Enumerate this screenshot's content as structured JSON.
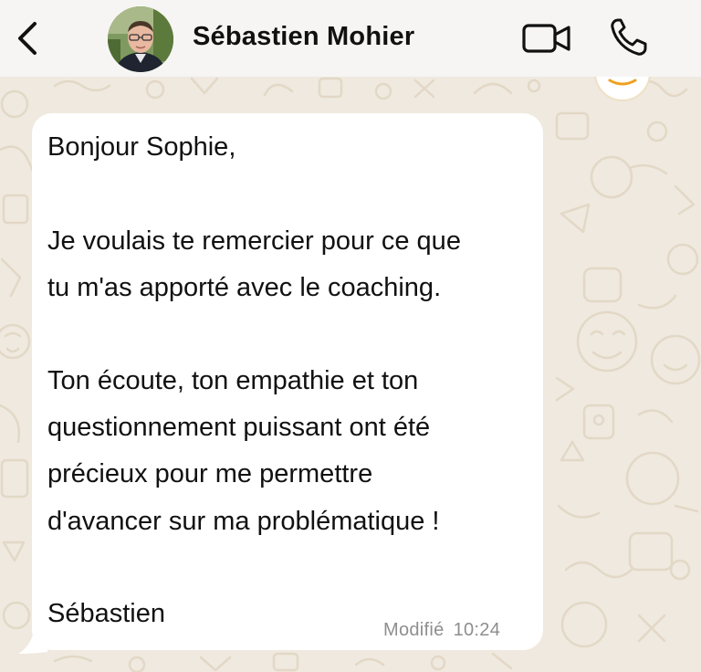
{
  "header": {
    "contact_name": "Sébastien Mohier"
  },
  "message": {
    "lines": [
      "Bonjour Sophie,",
      "",
      "Je voulais te remercier pour ce que",
      "tu m'as apporté avec le coaching.",
      "",
      "Ton écoute, ton empathie et ton",
      "questionnement puissant ont été",
      "précieux pour me permettre",
      "d'avancer sur ma problématique !",
      "",
      "Sébastien"
    ],
    "status": "Modifié",
    "time": "10:24"
  },
  "colors": {
    "header_bg": "#f6f5f3",
    "wallpaper_bg": "#efe9df",
    "doodle": "#e6dccb",
    "bubble_bg": "#ffffff",
    "meta_text": "#8e8e8e"
  },
  "icons": {
    "back": "chevron-left-icon",
    "video": "video-camera-icon",
    "call": "phone-icon"
  }
}
